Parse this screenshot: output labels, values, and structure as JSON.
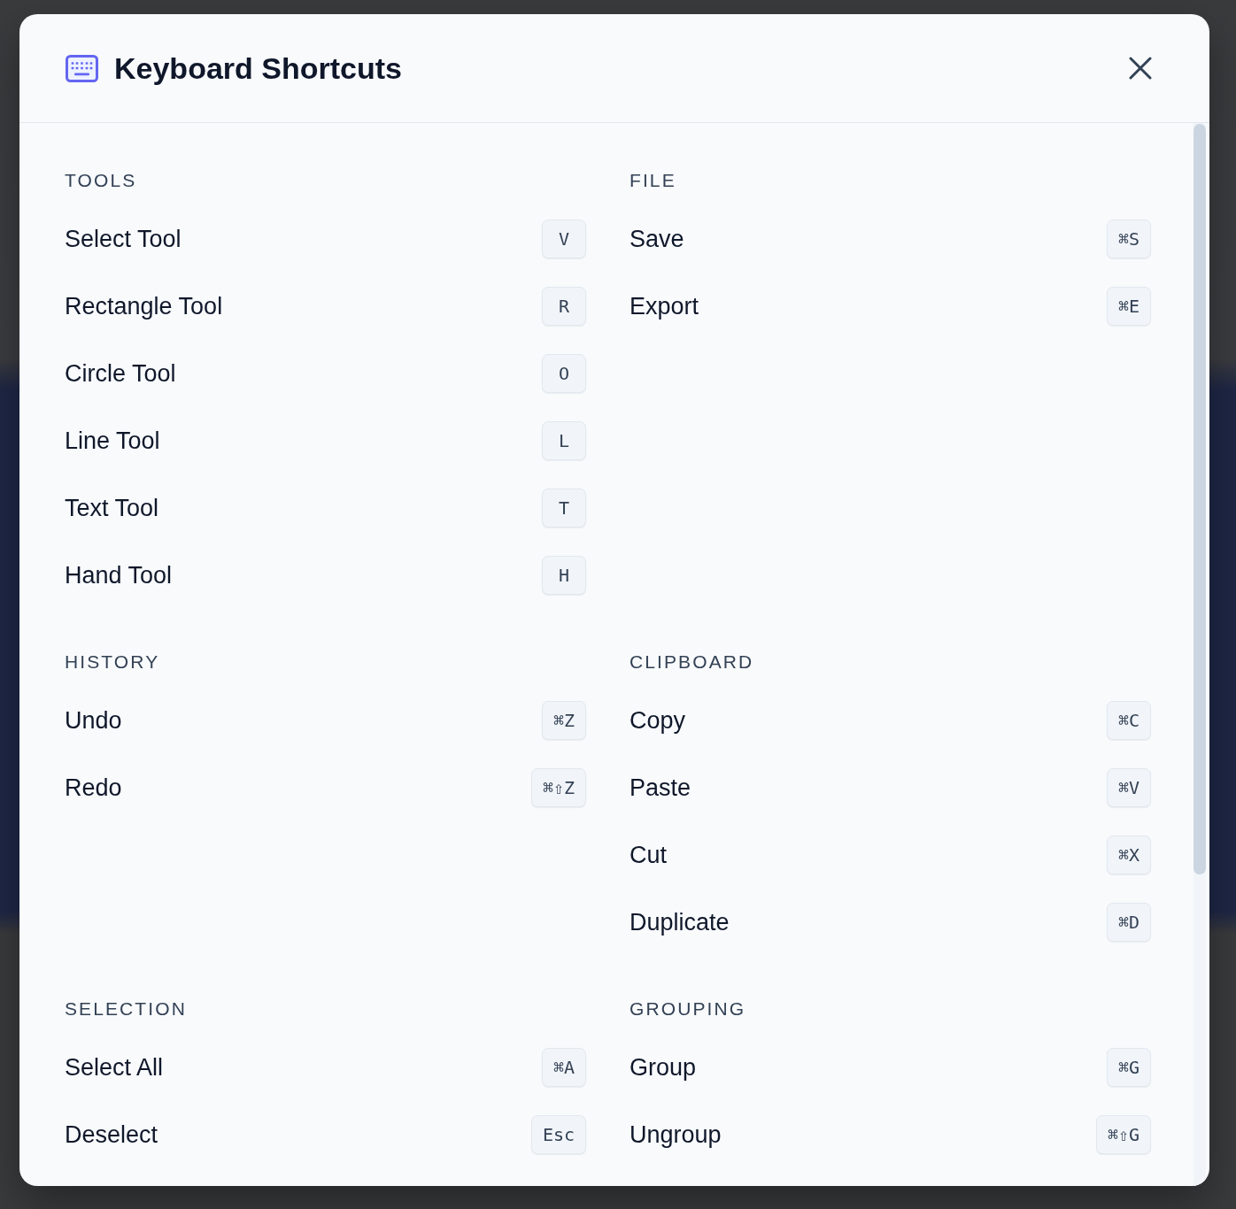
{
  "dialog": {
    "title": "Keyboard Shortcuts"
  },
  "sections": [
    {
      "heading": "TOOLS",
      "shortcuts": [
        {
          "label": "Select Tool",
          "keys": "V"
        },
        {
          "label": "Rectangle Tool",
          "keys": "R"
        },
        {
          "label": "Circle Tool",
          "keys": "O"
        },
        {
          "label": "Line Tool",
          "keys": "L"
        },
        {
          "label": "Text Tool",
          "keys": "T"
        },
        {
          "label": "Hand Tool",
          "keys": "H"
        }
      ]
    },
    {
      "heading": "FILE",
      "shortcuts": [
        {
          "label": "Save",
          "keys": "⌘S"
        },
        {
          "label": "Export",
          "keys": "⌘E"
        }
      ]
    },
    {
      "heading": "HISTORY",
      "shortcuts": [
        {
          "label": "Undo",
          "keys": "⌘Z"
        },
        {
          "label": "Redo",
          "keys": "⌘⇧Z"
        }
      ]
    },
    {
      "heading": "CLIPBOARD",
      "shortcuts": [
        {
          "label": "Copy",
          "keys": "⌘C"
        },
        {
          "label": "Paste",
          "keys": "⌘V"
        },
        {
          "label": "Cut",
          "keys": "⌘X"
        },
        {
          "label": "Duplicate",
          "keys": "⌘D"
        }
      ]
    },
    {
      "heading": "SELECTION",
      "shortcuts": [
        {
          "label": "Select All",
          "keys": "⌘A"
        },
        {
          "label": "Deselect",
          "keys": "Esc"
        }
      ]
    },
    {
      "heading": "GROUPING",
      "shortcuts": [
        {
          "label": "Group",
          "keys": "⌘G"
        },
        {
          "label": "Ungroup",
          "keys": "⌘⇧G"
        }
      ]
    }
  ]
}
